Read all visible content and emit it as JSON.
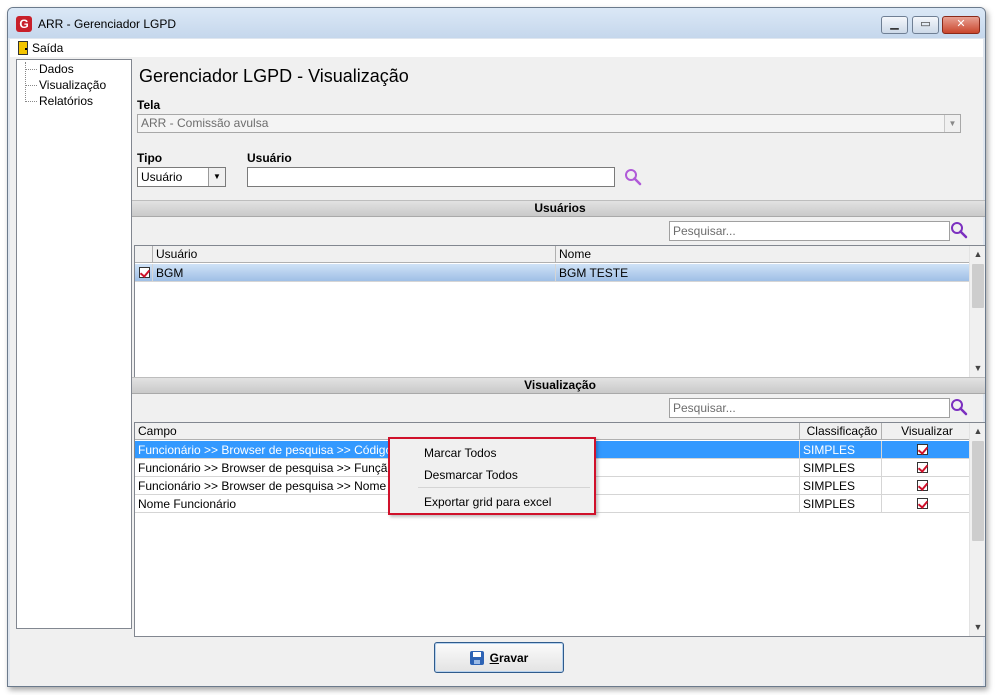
{
  "window": {
    "title": "ARR - Gerenciador LGPD",
    "icon": "g-app-icon"
  },
  "window_buttons": {
    "minimize": "minimize-icon",
    "maximize": "maximize-icon",
    "close": "close-icon"
  },
  "menu": {
    "exit_label": "Saída",
    "exit_icon": "door-exit-icon"
  },
  "sidebar": {
    "items": [
      {
        "label": "Dados"
      },
      {
        "label": "Visualização"
      },
      {
        "label": "Relatórios"
      }
    ]
  },
  "main": {
    "title": "Gerenciador LGPD - Visualização",
    "tela_label": "Tela",
    "tela_value": "ARR - Comissão avulsa",
    "tipo_label": "Tipo",
    "tipo_value": "Usuário",
    "usuario_label": "Usuário",
    "usuario_value": ""
  },
  "usuarios": {
    "header": "Usuários",
    "search_placeholder": "Pesquisar...",
    "columns": [
      "Usuário",
      "Nome"
    ],
    "rows": [
      {
        "checked": true,
        "usuario": "BGM",
        "nome": "BGM TESTE"
      }
    ]
  },
  "visualizacao": {
    "header": "Visualização",
    "search_placeholder": "Pesquisar...",
    "columns": [
      "Campo",
      "Classificação",
      "Visualizar"
    ],
    "rows": [
      {
        "campo": "Funcionário >> Browser de pesquisa >> Código",
        "classificacao": "SIMPLES",
        "visualizar": true
      },
      {
        "campo": "Funcionário >> Browser de pesquisa >> Função",
        "classificacao": "SIMPLES",
        "visualizar": true
      },
      {
        "campo": "Funcionário >> Browser de pesquisa >> Nome",
        "classificacao": "SIMPLES",
        "visualizar": true
      },
      {
        "campo": "Nome Funcionário",
        "classificacao": "SIMPLES",
        "visualizar": true
      }
    ]
  },
  "context_menu": {
    "items": [
      "Marcar Todos",
      "Desmarcar Todos",
      "Exportar grid para excel"
    ]
  },
  "footer": {
    "save_label": "Gravar",
    "save_underline": "G",
    "save_rest": "ravar"
  },
  "colors": {
    "accent_red": "#d0112b",
    "selection_blue": "#3399ff",
    "search_purple": "#7b2fbf"
  }
}
